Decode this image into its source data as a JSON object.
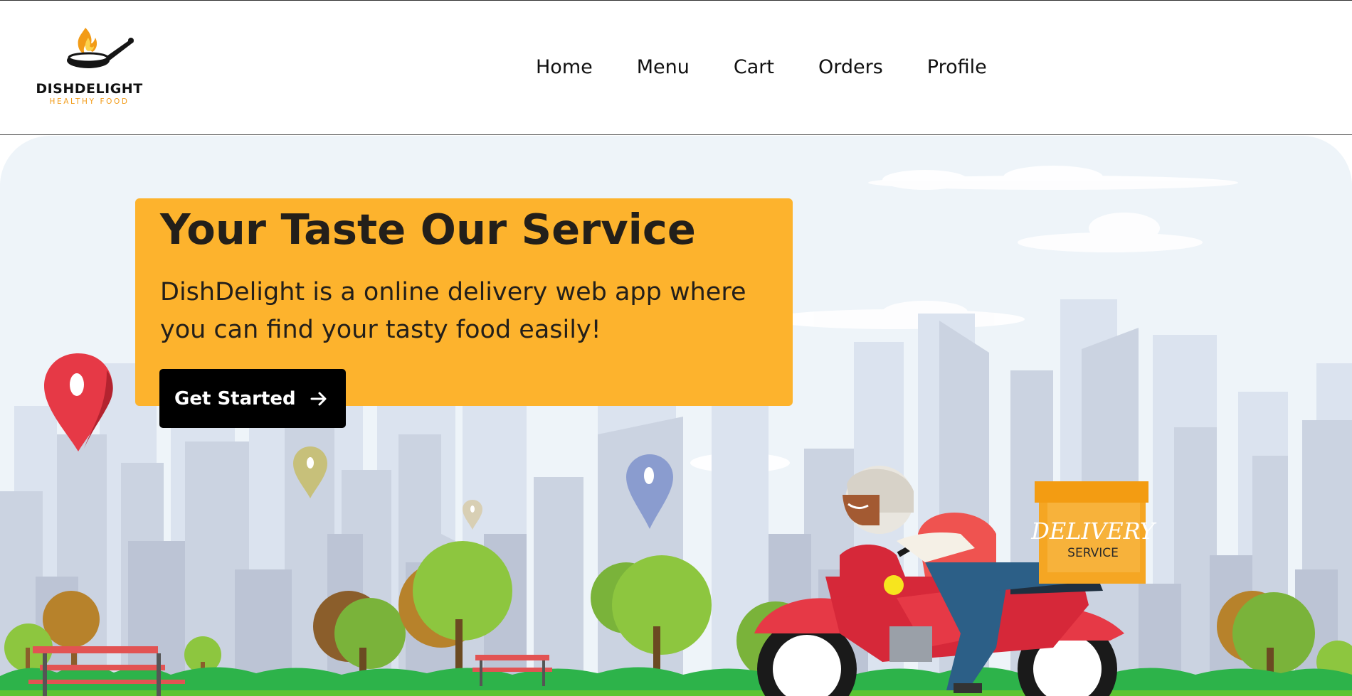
{
  "brand": {
    "name": "DISHDELIGHT",
    "tagline": "HEALTHY FOOD",
    "accent_color": "#f29b17"
  },
  "nav": {
    "items": [
      {
        "label": "Home"
      },
      {
        "label": "Menu"
      },
      {
        "label": "Cart"
      },
      {
        "label": "Orders"
      },
      {
        "label": "Profile"
      }
    ]
  },
  "hero": {
    "title": "Your Taste Our Service",
    "description": "DishDelight is a online delivery web app where you can find your tasty food easily!",
    "card_color": "#fdb32d",
    "cta": {
      "label": "Get Started",
      "icon": "arrow-right-icon"
    },
    "illustration": {
      "box_text_main": "DELIVERY",
      "box_text_sub": "SERVICE"
    }
  }
}
